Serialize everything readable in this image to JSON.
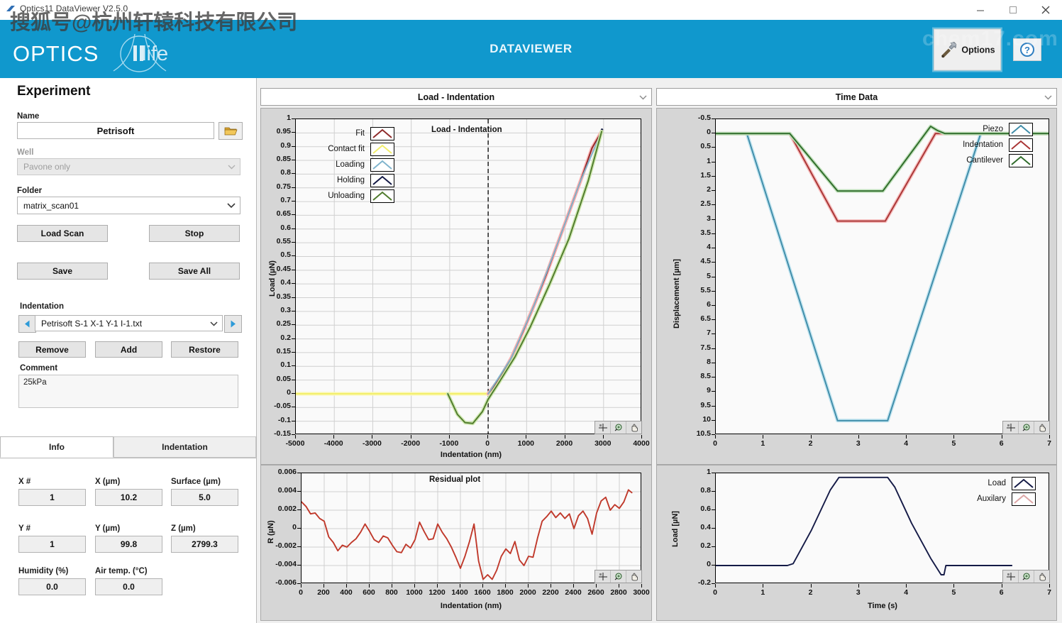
{
  "window": {
    "title": "Optics11 DataViewer V2.5.0",
    "minimize": "–",
    "maximize": "▭",
    "close": "✕"
  },
  "header": {
    "brand_primary": "OPTICS",
    "brand_secondary": "life",
    "app_name": "DATAVIEWER",
    "options_label": "Options",
    "options_icon": "tools-icon",
    "help_icon": "help-icon",
    "bg_color": "#1098cd"
  },
  "watermarks": {
    "top_left": "搜狐号@杭州轩辕科技有限公司",
    "top_right": "chem17.com"
  },
  "experiment": {
    "section_title": "Experiment",
    "name_label": "Name",
    "name_value": "Petrisoft",
    "folder_browse_icon": "folder-open-icon",
    "well_label": "Well",
    "well_value": "Pavone only",
    "folder_label": "Folder",
    "folder_value": "matrix_scan01",
    "buttons": {
      "load_scan": "Load Scan",
      "stop": "Stop",
      "save": "Save",
      "save_all": "Save All"
    },
    "indentation_label": "Indentation",
    "indentation_value": "Petrisoft S-1 X-1 Y-1 I-1.txt",
    "prev_icon": "previous-arrow-icon",
    "next_icon": "next-arrow-icon",
    "row_buttons": {
      "remove": "Remove",
      "add": "Add",
      "restore": "Restore"
    },
    "comment_label": "Comment",
    "comment_value": "25kPa"
  },
  "tabs": [
    {
      "label": "Info",
      "active": true
    },
    {
      "label": "Indentation",
      "active": false
    }
  ],
  "info_fields": [
    {
      "label": "X #",
      "value": "1"
    },
    {
      "label": "X (µm)",
      "value": "10.2"
    },
    {
      "label": "Surface (µm)",
      "value": "5.0"
    },
    {
      "label": "Y #",
      "value": "1"
    },
    {
      "label": "Y (µm)",
      "value": "99.8"
    },
    {
      "label": "Z (µm)",
      "value": "2799.3"
    },
    {
      "label": "Humidity (%)",
      "value": "0.0"
    },
    {
      "label": "Air temp. (°C)",
      "value": "0.0"
    }
  ],
  "panes": {
    "left_header": "Load - Indentation",
    "right_header": "Time Data",
    "chevron_icon": "chevron-down-icon"
  },
  "plot_toolbar": {
    "cursor_icon": "crosshair-cursor-icon",
    "zoom_icon": "zoom-magnifier-icon",
    "pan_icon": "pan-hand-icon"
  },
  "chart_data": [
    {
      "id": "load-indentation",
      "type": "line",
      "title": "Load - Indentation",
      "xlabel": "Indentation (nm)",
      "ylabel": "Load (µN)",
      "xlim": [
        -5000,
        4000
      ],
      "ylim": [
        -0.15,
        1
      ],
      "xticks": [
        -5000,
        -4000,
        -3000,
        -2000,
        -1000,
        0,
        1000,
        2000,
        3000,
        4000
      ],
      "yticks": [
        1,
        0.95,
        0.9,
        0.85,
        0.8,
        0.75,
        0.7,
        0.65,
        0.6,
        0.55,
        0.5,
        0.45,
        0.4,
        0.35,
        0.3,
        0.25,
        0.2,
        0.15,
        0.1,
        0.05,
        0,
        -0.05,
        -0.1,
        -0.15
      ],
      "grid": true,
      "legend_position": "top-left",
      "legend": [
        {
          "name": "Fit",
          "color": "#8e2a2a"
        },
        {
          "name": "Contact fit",
          "color": "#f2ee6a"
        },
        {
          "name": "Loading",
          "color": "#7fb4cd"
        },
        {
          "name": "Holding",
          "color": "#141a46"
        },
        {
          "name": "Unloading",
          "color": "#4f7a2c"
        }
      ],
      "annotations": [
        {
          "type": "vline",
          "x": 0,
          "style": "dashed"
        }
      ],
      "series": [
        {
          "name": "Contact fit",
          "color": "#f2ee6a",
          "x": [
            -5000,
            -1100,
            0
          ],
          "y": [
            0,
            0,
            0
          ]
        },
        {
          "name": "Fit",
          "color": "#8e2a2a",
          "x": [
            0,
            300,
            600,
            900,
            1200,
            1500,
            1800,
            2100,
            2400,
            2700,
            2950
          ],
          "y": [
            0.0,
            0.055,
            0.13,
            0.225,
            0.325,
            0.43,
            0.545,
            0.66,
            0.775,
            0.895,
            0.955
          ]
        },
        {
          "name": "Loading",
          "color": "#7fb4cd",
          "x": [
            0,
            600,
            1200,
            1800,
            2400,
            2950
          ],
          "y": [
            0.0,
            0.13,
            0.325,
            0.545,
            0.775,
            0.955
          ]
        },
        {
          "name": "Holding",
          "color": "#141a46",
          "x": [
            2880,
            2960
          ],
          "y": [
            0.93,
            0.962
          ]
        },
        {
          "name": "Unloading",
          "color": "#4f7a2c",
          "x": [
            -1050,
            -800,
            -600,
            -400,
            -150,
            0,
            300,
            700,
            1100,
            1600,
            2100,
            2600,
            2950
          ],
          "y": [
            0.0,
            -0.075,
            -0.105,
            -0.108,
            -0.065,
            -0.02,
            0.045,
            0.135,
            0.245,
            0.4,
            0.565,
            0.775,
            0.955
          ]
        }
      ]
    },
    {
      "id": "residual-plot",
      "type": "line",
      "title": "Residual plot",
      "xlabel": "Indentation (nm)",
      "ylabel": "R (µN)",
      "xlim": [
        0,
        3000
      ],
      "ylim": [
        -0.006,
        0.006
      ],
      "xticks": [
        0,
        200,
        400,
        600,
        800,
        1000,
        1200,
        1400,
        1600,
        1800,
        2000,
        2200,
        2400,
        2600,
        2800,
        3000
      ],
      "yticks": [
        0.006,
        0.004,
        0.002,
        0,
        -0.002,
        -0.004,
        -0.006
      ],
      "grid": true,
      "series": [
        {
          "name": "Residual",
          "color": "#c0392b",
          "x": [
            0,
            40,
            80,
            120,
            160,
            200,
            240,
            280,
            320,
            360,
            400,
            440,
            480,
            520,
            560,
            600,
            640,
            680,
            720,
            760,
            800,
            840,
            880,
            920,
            960,
            1000,
            1040,
            1080,
            1120,
            1160,
            1200,
            1240,
            1280,
            1320,
            1360,
            1400,
            1440,
            1480,
            1520,
            1560,
            1600,
            1640,
            1680,
            1720,
            1760,
            1800,
            1840,
            1880,
            1920,
            1960,
            2000,
            2040,
            2080,
            2120,
            2160,
            2200,
            2240,
            2280,
            2320,
            2360,
            2400,
            2440,
            2480,
            2520,
            2560,
            2600,
            2640,
            2680,
            2720,
            2760,
            2800,
            2840,
            2880,
            2910
          ],
          "y": [
            0.0029,
            0.0024,
            0.0016,
            0.0017,
            0.0011,
            0.0008,
            -0.0009,
            -0.0015,
            -0.0024,
            -0.0018,
            -0.002,
            -0.0015,
            -0.0011,
            -0.0004,
            0.0005,
            -0.0003,
            -0.0012,
            -0.0015,
            -0.0008,
            -0.001,
            -0.0018,
            -0.0025,
            -0.0026,
            -0.0017,
            -0.0021,
            -0.0012,
            0.0007,
            -0.0003,
            -0.0012,
            -0.0011,
            0.0005,
            -0.0004,
            -0.0011,
            -0.002,
            -0.0031,
            -0.0043,
            -0.003,
            -0.0014,
            0.0005,
            -0.0035,
            -0.0055,
            -0.005,
            -0.0055,
            -0.0045,
            -0.003,
            -0.0022,
            -0.0027,
            -0.0014,
            -0.0034,
            -0.004,
            -0.003,
            -0.0031,
            -0.001,
            0.0008,
            0.0013,
            0.0019,
            0.0012,
            0.0017,
            0.0011,
            0.0016,
            0.0,
            0.0014,
            0.0019,
            0.0011,
            -0.0006,
            0.0017,
            0.003,
            0.0034,
            0.002,
            0.0026,
            0.0022,
            0.0029,
            0.0042,
            0.0039
          ]
        }
      ]
    },
    {
      "id": "time-data-displacement",
      "type": "line",
      "title": "Time Data",
      "xlabel": "",
      "ylabel": "Displacement [µm]",
      "xlim": [
        0,
        7
      ],
      "ylim": [
        -0.5,
        10.5
      ],
      "y_inverted": true,
      "xticks": [
        0,
        1,
        2,
        3,
        4,
        5,
        6,
        7
      ],
      "yticks": [
        -0.5,
        0,
        0.5,
        1,
        1.5,
        2,
        2.5,
        3,
        3.5,
        4,
        4.5,
        5,
        5.5,
        6,
        6.5,
        7,
        7.5,
        8,
        8.5,
        9,
        9.5,
        10,
        10.5
      ],
      "grid": false,
      "legend_position": "top-right",
      "legend": [
        {
          "name": "Piezo",
          "color": "#3f8ca8"
        },
        {
          "name": "Indentation",
          "color": "#a93535"
        },
        {
          "name": "Cantilever",
          "color": "#2f6b2a"
        }
      ],
      "series": [
        {
          "name": "Piezo",
          "color": "#3f8ca8",
          "x": [
            0,
            0.65,
            2.55,
            3.6,
            5.55,
            6.2,
            7
          ],
          "y": [
            0,
            0,
            10,
            10,
            0,
            0,
            0
          ]
        },
        {
          "name": "Indentation",
          "color": "#a93535",
          "x": [
            0,
            1.55,
            2.55,
            3.55,
            4.6,
            6.2,
            7
          ],
          "y": [
            0,
            0,
            3.05,
            3.05,
            0,
            0,
            0
          ]
        },
        {
          "name": "Cantilever",
          "color": "#2f6b2a",
          "x": [
            0,
            1.55,
            2.55,
            3.5,
            4.5,
            4.65,
            4.8,
            6.2,
            7
          ],
          "y": [
            0,
            0,
            2.0,
            2.0,
            -0.25,
            -0.1,
            0,
            0,
            0
          ]
        }
      ]
    },
    {
      "id": "time-data-load",
      "type": "line",
      "title": "",
      "xlabel": "Time (s)",
      "ylabel": "Load [µN]",
      "xlim": [
        0,
        7
      ],
      "ylim": [
        -0.2,
        1
      ],
      "xticks": [
        0,
        1,
        2,
        3,
        4,
        5,
        6,
        7
      ],
      "yticks": [
        1,
        0.8,
        0.6,
        0.4,
        0.2,
        0,
        -0.2
      ],
      "grid": false,
      "legend_position": "top-right",
      "legend": [
        {
          "name": "Load",
          "color": "#141a46"
        },
        {
          "name": "Auxilary",
          "color": "#dda5a5"
        }
      ],
      "series": [
        {
          "name": "Load",
          "color": "#141a46",
          "x": [
            0,
            1.5,
            1.62,
            2.0,
            2.4,
            2.58,
            3.6,
            3.75,
            4.1,
            4.5,
            4.72,
            4.78,
            4.82,
            6.2
          ],
          "y": [
            0,
            0,
            0.02,
            0.38,
            0.82,
            0.955,
            0.955,
            0.85,
            0.46,
            0.08,
            -0.1,
            -0.1,
            0.0,
            0.0
          ]
        }
      ]
    }
  ]
}
